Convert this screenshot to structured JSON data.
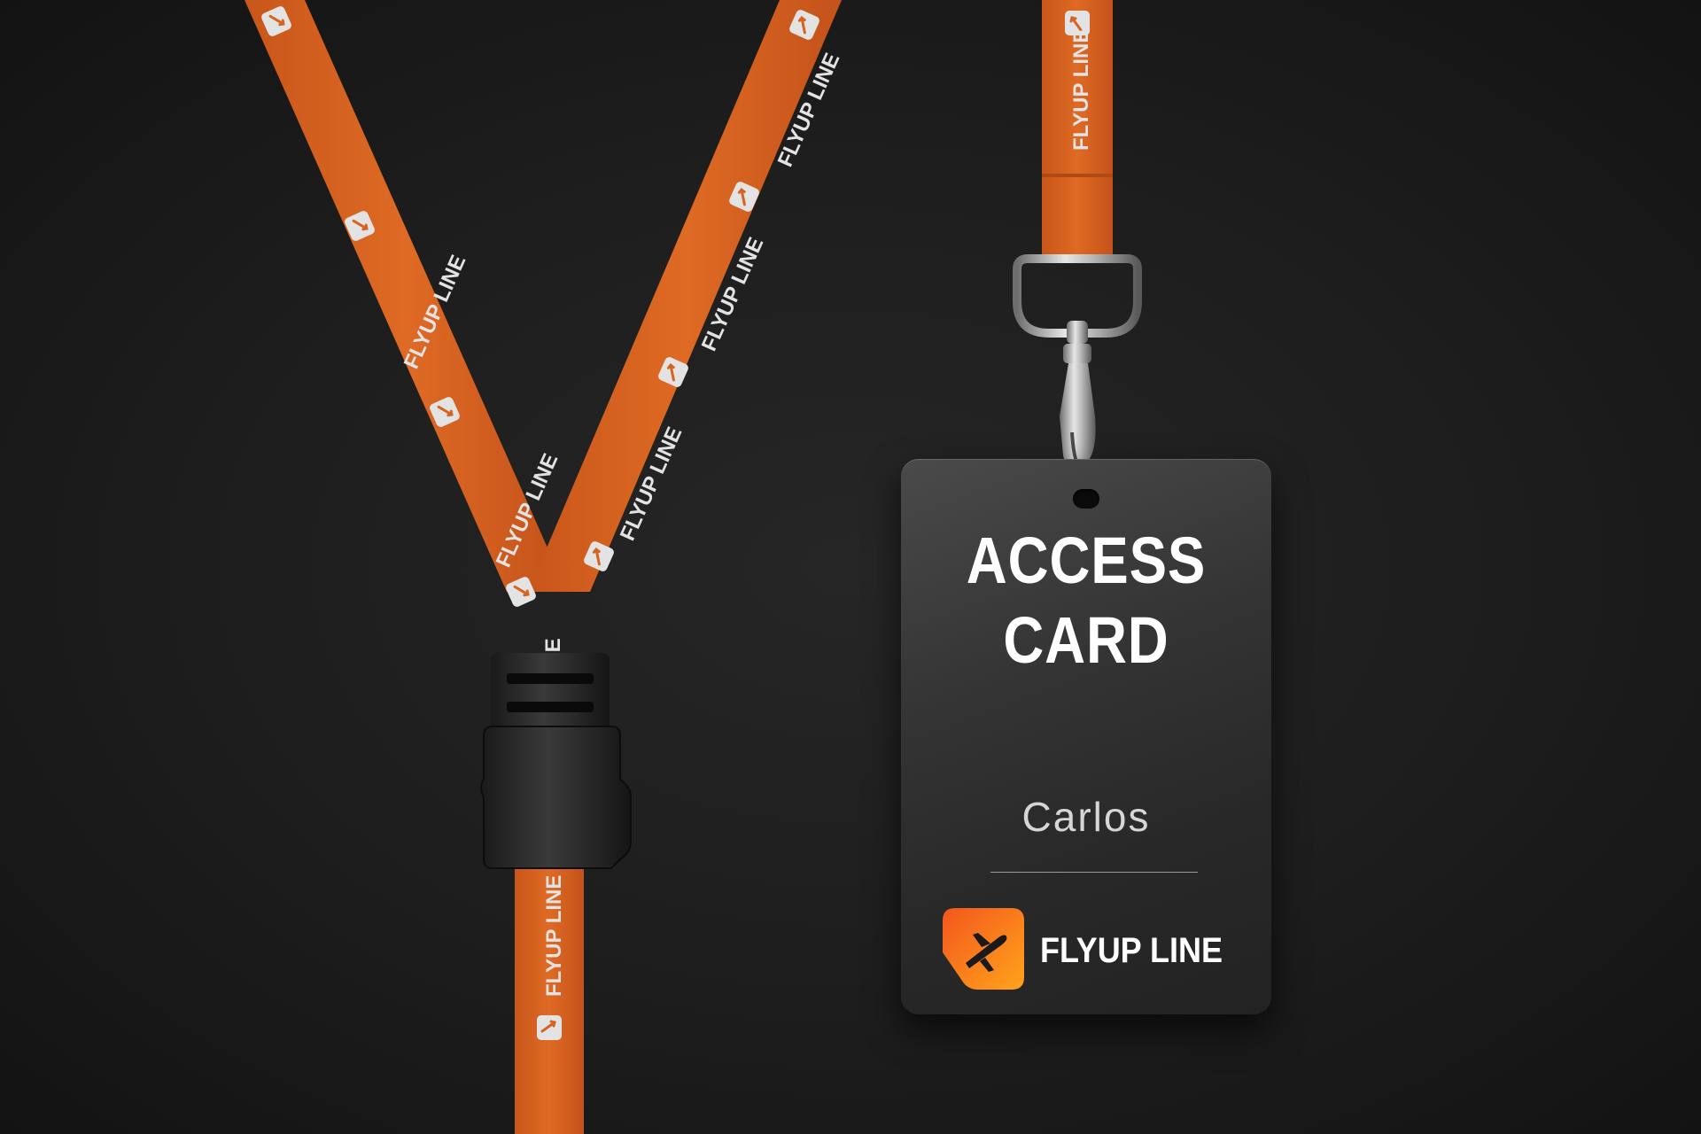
{
  "card": {
    "title_line1": "ACCESS",
    "title_line2": "CARD",
    "name": "Carlos",
    "brand": "FLYUP LINE"
  },
  "lanyard": {
    "print_text": "FLYUP LINE",
    "print_text_fragment": "LINE"
  },
  "colors": {
    "background": "#1e1e1e",
    "strap_orange": "#d86320",
    "strap_print": "#e3e3e3",
    "card": "#2e2e2e",
    "logo_gradient_start": "#f3561d",
    "logo_gradient_end": "#ffa41c"
  },
  "icons": {
    "logo": "airplane-in-rounded-square-icon"
  }
}
